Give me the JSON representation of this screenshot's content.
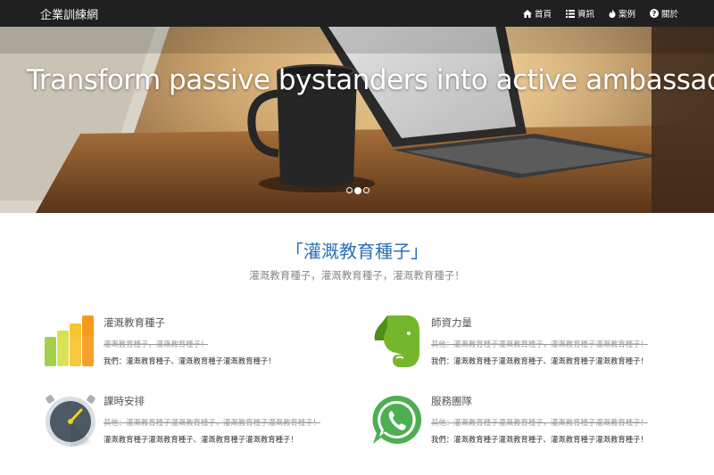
{
  "navbar": {
    "brand": "企業訓練網",
    "items": [
      {
        "icon": "home-icon",
        "label": "首頁"
      },
      {
        "icon": "list-icon",
        "label": "資訊"
      },
      {
        "icon": "fire-icon",
        "label": "案例"
      },
      {
        "icon": "question-circle-icon",
        "label": "關於"
      }
    ]
  },
  "hero": {
    "title": "Transform passive bystanders into active ambassadors",
    "slides": 3,
    "active_slide": 2
  },
  "section": {
    "title": "「灌溉教育種子」",
    "subtitle": "灌溉教育種子，灌溉教育種子，灌溉教育種子！"
  },
  "features": [
    {
      "icon": "bar-chart-icon",
      "title": "灌溉教育種子",
      "strike": "灌溉教育種子，灌溉教育種子！",
      "desc": "我們：灌溉教育種子、灌溉教育種子灌溉教育種子！"
    },
    {
      "icon": "evernote-icon",
      "title": "師資力量",
      "strike": "其他：灌溉教育種子灌溉教育種子，灌溉教育種子灌溉教育種子！",
      "desc": "我們：灌溉教育種子灌溉教育種子、灌溉教育種子灌溉教育種子！"
    },
    {
      "icon": "stopwatch-icon",
      "title": "課時安排",
      "strike": "其他：灌溉教育種子灌溉教育種子，灌溉教育種子灌溉教育種子！",
      "desc": "灌溉教育種子灌溉教育種子、灌溉教育種子灌溉教育種子！"
    },
    {
      "icon": "whatsapp-icon",
      "title": "服務團隊",
      "strike": "其他：灌溉教育種子灌溉教育種子，灌溉教育種子灌溉教育種子！",
      "desc": "我們：灌溉教育種子灌溉教育種子、灌溉教育種子灌溉教育種子！"
    }
  ],
  "colors": {
    "navbar": "#202020",
    "accent_title": "#2a6fb5",
    "subtitle": "#888888"
  }
}
